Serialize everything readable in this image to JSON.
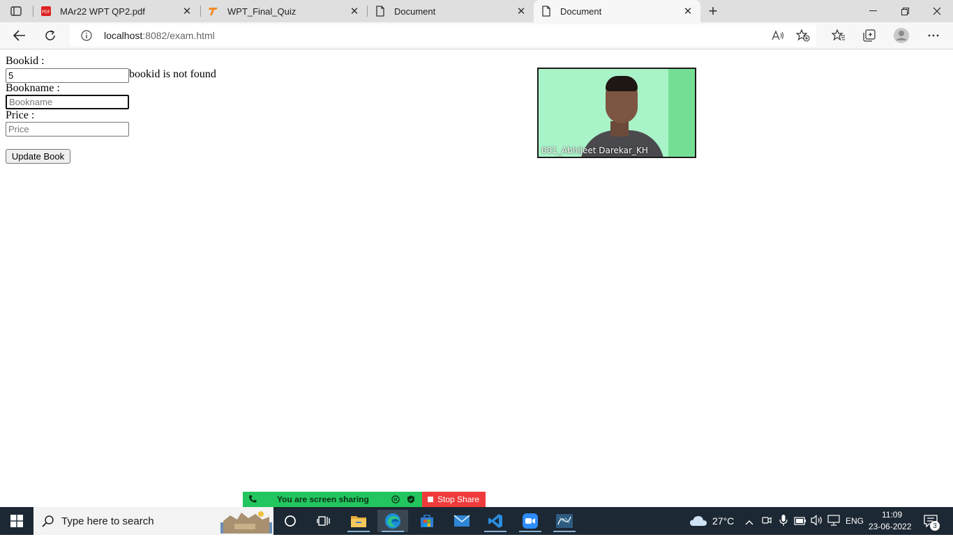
{
  "browser": {
    "tabs": [
      {
        "title": "MAr22 WPT QP2.pdf",
        "icon": "pdf-icon"
      },
      {
        "title": "WPT_Final_Quiz",
        "icon": "quiz-t-icon"
      },
      {
        "title": "Document",
        "icon": "document-icon"
      },
      {
        "title": "Document",
        "icon": "document-icon",
        "active": true
      }
    ],
    "url_host": "localhost",
    "url_rest": ":8082/exam.html"
  },
  "form": {
    "bookid_label": "Bookid :",
    "bookid_value": "5",
    "bookid_message": "bookid is not found",
    "bookname_label": "Bookname :",
    "bookname_placeholder": "Bookname",
    "price_label": "Price :",
    "price_placeholder": "Price",
    "submit_label": "Update Book"
  },
  "video": {
    "participant_name": "001_Abhijeet Darekar_KH"
  },
  "screenshare": {
    "status_text": "You are screen sharing",
    "stop_label": "Stop Share"
  },
  "taskbar": {
    "search_placeholder": "Type here to search",
    "weather": "27°C",
    "language": "ENG",
    "time": "11:09",
    "date": "23-06-2022",
    "notification_count": "3"
  },
  "colors": {
    "share_green": "#22c55e",
    "share_red": "#ef3b3b",
    "taskbar_bg": "#1c2833"
  }
}
